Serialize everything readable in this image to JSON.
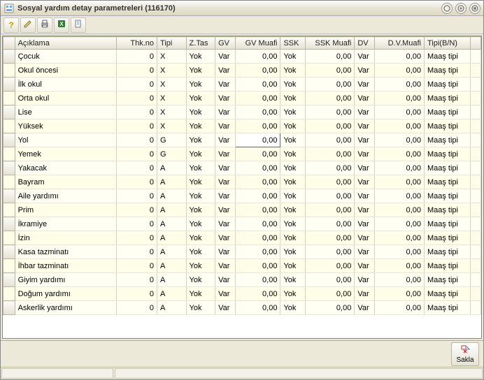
{
  "window": {
    "title": "Sosyal yardım detay parametreleri (116170)"
  },
  "toolbar": {
    "icons": [
      "?",
      "✎",
      "⎙",
      "X",
      "☐"
    ]
  },
  "grid": {
    "headers": {
      "rowhdr": "",
      "aciklama": "Açıklama",
      "thk": "Thk.no",
      "tipi": "Tipi",
      "ztas": "Z.Tas",
      "gv": "GV",
      "gvmuaf": "GV Muafi",
      "ssk": "SSK",
      "sskmuaf": "SSK Muafi",
      "dv": "DV",
      "dvmuaf": "D.V.Muafi",
      "tipibn": "Tipi(B/N)"
    },
    "rows": [
      {
        "aciklama": "Çocuk",
        "thk": "0",
        "tipi": "X",
        "ztas": "Yok",
        "gv": "Var",
        "gvmuaf": "0,00",
        "ssk": "Yok",
        "sskmuaf": "0,00",
        "dv": "Var",
        "dvmuaf": "0,00",
        "tipibn": "Maaş tipi"
      },
      {
        "aciklama": "Okul öncesi",
        "thk": "0",
        "tipi": "X",
        "ztas": "Yok",
        "gv": "Var",
        "gvmuaf": "0,00",
        "ssk": "Yok",
        "sskmuaf": "0,00",
        "dv": "Var",
        "dvmuaf": "0,00",
        "tipibn": "Maaş tipi"
      },
      {
        "aciklama": "İlk okul",
        "thk": "0",
        "tipi": "X",
        "ztas": "Yok",
        "gv": "Var",
        "gvmuaf": "0,00",
        "ssk": "Yok",
        "sskmuaf": "0,00",
        "dv": "Var",
        "dvmuaf": "0,00",
        "tipibn": "Maaş tipi"
      },
      {
        "aciklama": "Orta okul",
        "thk": "0",
        "tipi": "X",
        "ztas": "Yok",
        "gv": "Var",
        "gvmuaf": "0,00",
        "ssk": "Yok",
        "sskmuaf": "0,00",
        "dv": "Var",
        "dvmuaf": "0,00",
        "tipibn": "Maaş tipi"
      },
      {
        "aciklama": "Lise",
        "thk": "0",
        "tipi": "X",
        "ztas": "Yok",
        "gv": "Var",
        "gvmuaf": "0,00",
        "ssk": "Yok",
        "sskmuaf": "0,00",
        "dv": "Var",
        "dvmuaf": "0,00",
        "tipibn": "Maaş tipi"
      },
      {
        "aciklama": "Yüksek",
        "thk": "0",
        "tipi": "X",
        "ztas": "Yok",
        "gv": "Var",
        "gvmuaf": "0,00",
        "ssk": "Yok",
        "sskmuaf": "0,00",
        "dv": "Var",
        "dvmuaf": "0,00",
        "tipibn": "Maaş tipi"
      },
      {
        "aciklama": "Yol",
        "thk": "0",
        "tipi": "G",
        "ztas": "Yok",
        "gv": "Var",
        "gvmuaf": "0,00",
        "ssk": "Yok",
        "sskmuaf": "0,00",
        "dv": "Var",
        "dvmuaf": "0,00",
        "tipibn": "Maaş tipi",
        "active": true
      },
      {
        "aciklama": "Yemek",
        "thk": "0",
        "tipi": "G",
        "ztas": "Yok",
        "gv": "Var",
        "gvmuaf": "0,00",
        "ssk": "Yok",
        "sskmuaf": "0,00",
        "dv": "Var",
        "dvmuaf": "0,00",
        "tipibn": "Maaş tipi"
      },
      {
        "aciklama": "Yakacak",
        "thk": "0",
        "tipi": "A",
        "ztas": "Yok",
        "gv": "Var",
        "gvmuaf": "0,00",
        "ssk": "Yok",
        "sskmuaf": "0,00",
        "dv": "Var",
        "dvmuaf": "0,00",
        "tipibn": "Maaş tipi"
      },
      {
        "aciklama": "Bayram",
        "thk": "0",
        "tipi": "A",
        "ztas": "Yok",
        "gv": "Var",
        "gvmuaf": "0,00",
        "ssk": "Yok",
        "sskmuaf": "0,00",
        "dv": "Var",
        "dvmuaf": "0,00",
        "tipibn": "Maaş tipi"
      },
      {
        "aciklama": "Aile yardımı",
        "thk": "0",
        "tipi": "A",
        "ztas": "Yok",
        "gv": "Var",
        "gvmuaf": "0,00",
        "ssk": "Yok",
        "sskmuaf": "0,00",
        "dv": "Var",
        "dvmuaf": "0,00",
        "tipibn": "Maaş tipi"
      },
      {
        "aciklama": "Prim",
        "thk": "0",
        "tipi": "A",
        "ztas": "Yok",
        "gv": "Var",
        "gvmuaf": "0,00",
        "ssk": "Yok",
        "sskmuaf": "0,00",
        "dv": "Var",
        "dvmuaf": "0,00",
        "tipibn": "Maaş tipi"
      },
      {
        "aciklama": "İkramiye",
        "thk": "0",
        "tipi": "A",
        "ztas": "Yok",
        "gv": "Var",
        "gvmuaf": "0,00",
        "ssk": "Yok",
        "sskmuaf": "0,00",
        "dv": "Var",
        "dvmuaf": "0,00",
        "tipibn": "Maaş tipi"
      },
      {
        "aciklama": "İzin",
        "thk": "0",
        "tipi": "A",
        "ztas": "Yok",
        "gv": "Var",
        "gvmuaf": "0,00",
        "ssk": "Yok",
        "sskmuaf": "0,00",
        "dv": "Var",
        "dvmuaf": "0,00",
        "tipibn": "Maaş tipi"
      },
      {
        "aciklama": "Kasa tazminatı",
        "thk": "0",
        "tipi": "A",
        "ztas": "Yok",
        "gv": "Var",
        "gvmuaf": "0,00",
        "ssk": "Yok",
        "sskmuaf": "0,00",
        "dv": "Var",
        "dvmuaf": "0,00",
        "tipibn": "Maaş tipi"
      },
      {
        "aciklama": "İhbar tazminatı",
        "thk": "0",
        "tipi": "A",
        "ztas": "Yok",
        "gv": "Var",
        "gvmuaf": "0,00",
        "ssk": "Yok",
        "sskmuaf": "0,00",
        "dv": "Var",
        "dvmuaf": "0,00",
        "tipibn": "Maaş tipi"
      },
      {
        "aciklama": "Giyim yardımı",
        "thk": "0",
        "tipi": "A",
        "ztas": "Yok",
        "gv": "Var",
        "gvmuaf": "0,00",
        "ssk": "Yok",
        "sskmuaf": "0,00",
        "dv": "Var",
        "dvmuaf": "0,00",
        "tipibn": "Maaş tipi"
      },
      {
        "aciklama": "Doğum yardımı",
        "thk": "0",
        "tipi": "A",
        "ztas": "Yok",
        "gv": "Var",
        "gvmuaf": "0,00",
        "ssk": "Yok",
        "sskmuaf": "0,00",
        "dv": "Var",
        "dvmuaf": "0,00",
        "tipibn": "Maaş tipi"
      },
      {
        "aciklama": "Askerlik yardımı",
        "thk": "0",
        "tipi": "A",
        "ztas": "Yok",
        "gv": "Var",
        "gvmuaf": "0,00",
        "ssk": "Yok",
        "sskmuaf": "0,00",
        "dv": "Var",
        "dvmuaf": "0,00",
        "tipibn": "Maaş tipi"
      }
    ]
  },
  "footer": {
    "save_label": "Sakla"
  }
}
